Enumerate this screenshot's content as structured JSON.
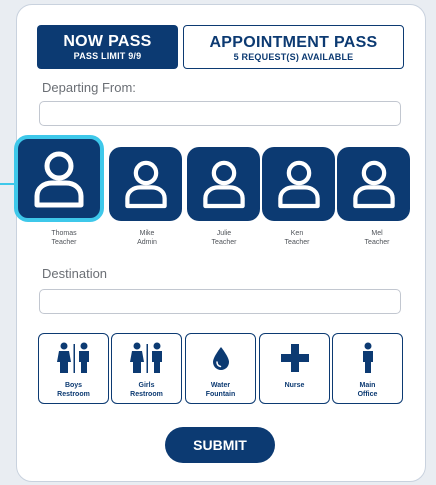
{
  "tabs": {
    "now": {
      "title": "NOW PASS",
      "subtitle": "PASS LIMIT 9/9"
    },
    "appointment": {
      "title": "APPOINTMENT PASS",
      "subtitle": "5 REQUEST(S) AVAILABLE"
    }
  },
  "departing": {
    "label": "Departing From:",
    "value": ""
  },
  "staff": [
    {
      "name": "Thomas",
      "role": "Teacher",
      "selected": true
    },
    {
      "name": "Mike",
      "role": "Admin",
      "selected": false
    },
    {
      "name": "Julie",
      "role": "Teacher",
      "selected": false
    },
    {
      "name": "Ken",
      "role": "Teacher",
      "selected": false
    },
    {
      "name": "Mel",
      "role": "Teacher",
      "selected": false
    }
  ],
  "destination": {
    "label": "Destination",
    "value": ""
  },
  "destinations": [
    {
      "line1": "Boys",
      "line2": "Restroom",
      "icon": "restroom-icon"
    },
    {
      "line1": "Girls",
      "line2": "Restroom",
      "icon": "restroom-icon"
    },
    {
      "line1": "Water",
      "line2": "Fountain",
      "icon": "water-drop-icon"
    },
    {
      "line1": "Nurse",
      "line2": "",
      "icon": "medical-cross-icon"
    },
    {
      "line1": "Main",
      "line2": "Office",
      "icon": "person-icon"
    }
  ],
  "submit_label": "SUBMIT",
  "colors": {
    "primary": "#0c3a72",
    "accent": "#3ec8ea",
    "background": "#e9edf2"
  }
}
